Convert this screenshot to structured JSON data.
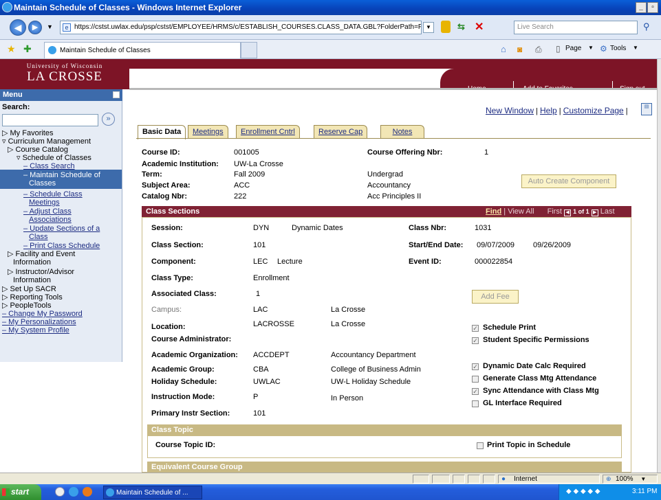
{
  "window": {
    "title": "Maintain Schedule of Classes - Windows Internet Explorer",
    "controls": [
      "_",
      "▫",
      "×"
    ]
  },
  "browser": {
    "back_icon": "back-arrow-icon",
    "forward_icon": "forward-arrow-icon",
    "url": "https://cstst.uwlax.edu/psp/cstst/EMPLOYEE/HRMS/c/ESTABLISH_COURSES.CLASS_DATA.GBL?FolderPath=PORTAL_R",
    "search_placeholder": "Live Search",
    "tab_title": "Maintain Schedule of Classes",
    "tools": "Page ▾   Tools ▾",
    "page_label": "Page",
    "tools_label": "Tools"
  },
  "banner": {
    "logo_line1": "University of Wisconsin",
    "logo_line2": "LA CROSSE",
    "links": [
      "Home",
      "Add to Favorites",
      "Sign out"
    ]
  },
  "sidebar": {
    "title": "Menu",
    "search_label": "Search:",
    "items": [
      {
        "label": "▷ My Favorites",
        "type": "folder"
      },
      {
        "label": "▿ Curriculum Management",
        "type": "folder"
      },
      {
        "label": "▷ Course Catalog",
        "type": "folder"
      },
      {
        "label": "▿ Schedule of Classes",
        "type": "folder"
      },
      {
        "label": "– Class Search",
        "type": "link"
      },
      {
        "label": "– Maintain Schedule of",
        "label2": "Classes",
        "type": "selected"
      },
      {
        "label": "– Schedule Class",
        "label2": "Meetings",
        "type": "link"
      },
      {
        "label": "– Adjust Class",
        "label2": "Associations",
        "type": "link"
      },
      {
        "label": "– Update Sections of a",
        "label2": "Class",
        "type": "link"
      },
      {
        "label": "– Print Class Schedule",
        "type": "link"
      },
      {
        "label": "▷ Facility and Event",
        "label2": "Information",
        "type": "folder"
      },
      {
        "label": "▷ Instructor/Advisor",
        "label2": "Information",
        "type": "folder"
      },
      {
        "label": "▷ Set Up SACR",
        "type": "folder"
      },
      {
        "label": "▷ Reporting Tools",
        "type": "folder"
      },
      {
        "label": "▷ PeopleTools",
        "type": "folder"
      },
      {
        "label": "– Change My Password",
        "type": "link"
      },
      {
        "label": "– My Personalizations",
        "type": "link"
      },
      {
        "label": "– My System Profile",
        "type": "link"
      }
    ]
  },
  "toolbar": {
    "new_window": "New Window",
    "help": "Help",
    "customize": "Customize Page"
  },
  "tabs": [
    "Basic Data",
    "Meetings",
    "Enrollment Cntrl",
    "Reserve Cap",
    "Notes"
  ],
  "header": {
    "course_id_label": "Course ID:",
    "course_id": "001005",
    "offering_label": "Course Offering Nbr:",
    "offering": "1",
    "institution_label": "Academic Institution:",
    "institution": "UW-La Crosse",
    "term_label": "Term:",
    "term": "Fall 2009",
    "career": "Undergrad",
    "subject_label": "Subject Area:",
    "subject": "ACC",
    "subject_desc": "Accountancy",
    "catalog_label": "Catalog Nbr:",
    "catalog": "222",
    "catalog_desc": "Acc Principles II",
    "auto_create": "Auto Create Component"
  },
  "class_sections": {
    "title": "Class Sections",
    "find": "Find",
    "view_all": "View All",
    "first": "First",
    "of": "1 of 1",
    "last": "Last",
    "session_label": "Session:",
    "session": "DYN",
    "session_desc": "Dynamic Dates",
    "class_nbr_label": "Class Nbr:",
    "class_nbr": "1031",
    "section_label": "Class Section:",
    "section": "101",
    "dates_label": "Start/End Date:",
    "start_date": "09/07/2009",
    "end_date": "09/26/2009",
    "component_label": "Component:",
    "component": "LEC",
    "component_desc": "Lecture",
    "event_label": "Event ID:",
    "event_id": "000022854",
    "type_label": "Class Type:",
    "type": "Enrollment",
    "assoc_label": "Associated Class:",
    "assoc": "1",
    "campus_label": "Campus:",
    "campus": "LAC",
    "campus_desc": "La Crosse",
    "add_fee": "Add Fee",
    "location_label": "Location:",
    "location": "LACROSSE",
    "location_desc": "La Crosse",
    "admin_label": "Course Administrator:",
    "org_label": "Academic Organization:",
    "org": "ACCDEPT",
    "org_desc": "Accountancy Department",
    "group_label": "Academic Group:",
    "group": "CBA",
    "group_desc": "College of Business Admin",
    "holiday_label": "Holiday Schedule:",
    "holiday": "UWLAC",
    "holiday_desc": "UW-L Holiday Schedule",
    "mode_label": "Instruction Mode:",
    "mode": "P",
    "mode_desc": "In Person",
    "primary_label": "Primary Instr Section:",
    "primary": "101",
    "checkboxes": [
      {
        "label": "Schedule Print",
        "checked": true
      },
      {
        "label": "Student Specific Permissions",
        "checked": true
      },
      {
        "label": "Dynamic Date Calc Required",
        "checked": true
      },
      {
        "label": "Generate Class Mtg Attendance",
        "checked": false
      },
      {
        "label": "Sync Attendance with Class Mtg",
        "checked": true
      },
      {
        "label": "GL Interface Required",
        "checked": false
      }
    ]
  },
  "class_topic": {
    "title": "Class Topic",
    "topic_label": "Course Topic ID:",
    "print_topic": "Print Topic in Schedule"
  },
  "equiv": {
    "title": "Equivalent Course Group"
  },
  "statusbar": {
    "zone": "Internet",
    "zoom": "100%"
  },
  "taskbar": {
    "start": "start",
    "task": "Maintain Schedule of ...",
    "clock": "3:11 PM"
  }
}
